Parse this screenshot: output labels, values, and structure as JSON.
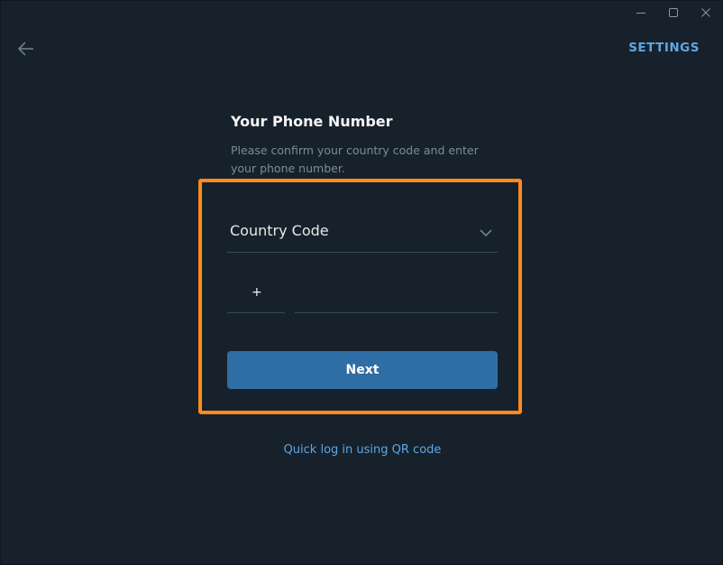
{
  "window": {
    "controls": [
      "minimize-icon",
      "maximize-icon",
      "close-icon"
    ]
  },
  "header": {
    "back_icon": "arrow-left-icon",
    "settings_label": "SETTINGS"
  },
  "form": {
    "title": "Your Phone Number",
    "description": "Please confirm your country code and enter your phone number.",
    "country_select_label": "Country Code",
    "country_code_prefix": "+",
    "country_code_value": "",
    "phone_value": "",
    "next_label": "Next"
  },
  "footer": {
    "qr_link_label": "Quick log in using QR code"
  },
  "colors": {
    "background": "#17212b",
    "accent": "#5ea7e4",
    "button": "#2f6ea5",
    "highlight": "#ff8a1d"
  }
}
